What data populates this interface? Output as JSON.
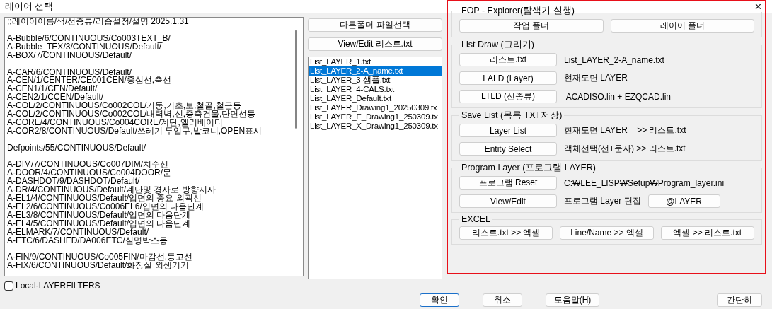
{
  "window": {
    "title": "레이어 선택",
    "close": "✕"
  },
  "layer_text": {
    "groups": [
      [
        ";;레이어이름/색/선종류/리습설정/설명 2025.1.31"
      ],
      [
        "A-Bubble/6/CONTINUOUS/Co003TEXT_B/",
        "A-Bubble_TEX/3/CONTINUOUS/Default/",
        "A-BOX/7/CONTINUOUS/Default/"
      ],
      [
        "A-CAR/6/CONTINUOUS/Default/",
        "A-CEN/1/CENTER/CE001CEN/중심선,축선",
        "A-CEN1/1/CEN/Default/",
        "A-CEN2/1/CCEN/Default/",
        "A-COL/2/CONTINUOUS/Co002COL/기둥,기초,보,철골,철근등",
        "A-COL/2/CONTINUOUS/Co002COL/내력벽,신,증축건물,단면선등",
        "A-CORE/4/CONTINUOUS/Co004CORE/계단,엘리베이터",
        "A-COR2/8/CONTINUOUS/Default/쓰레기 투입구,발코니,OPEN표시"
      ],
      [
        "Defpoints/55/CONTINUOUS/Default/"
      ],
      [
        "A-DIM/7/CONTINUOUS/Co007DIM/치수선",
        "A-DOOR/4/CONTINUOUS/Co004DOOR/문",
        "A-DASHDOT/9/DASHDOT/Default/",
        "A-DR/4/CONTINUOUS/Default/계단및 경사로 방향지사",
        "A-EL1/4/CONTINUOUS/Default/입면의 중요 외곽선",
        "A-EL2/6/CONTINUOUS/Co006EL6/입면의 다음단계",
        "A-EL3/8/CONTINUOUS/Default/입면의 다음단계",
        "A-EL4/5/CONTINUOUS/Default/입면의 다음단계",
        "A-ELMARK/7/CONTINUOUS/Default/",
        "A-ETC/6/DASHED/DA006ETC/실명박스등"
      ],
      [
        "A-FIN/9/CONTINUOUS/Co005FIN/마감선,등고선",
        "A-FIX/6/CONTINUOUS/Default/화장실 외생기기"
      ]
    ]
  },
  "local_filters": {
    "label": "Local-LAYERFILTERS",
    "checked": false
  },
  "file_buttons": [
    "다른폴더 파일선택",
    "View/Edit 리스트.txt"
  ],
  "file_list": [
    {
      "label": "List_LAYER_1.txt",
      "selected": false
    },
    {
      "label": "List_LAYER_2-A_name.txt",
      "selected": true
    },
    {
      "label": "List_LAYER_3-샘플.txt",
      "selected": false
    },
    {
      "label": "List_LAYER_4-CALS.txt",
      "selected": false
    },
    {
      "label": "List_LAYER_Default.txt",
      "selected": false
    },
    {
      "label": "List_LAYER_Drawing1_20250309.tx",
      "selected": false
    },
    {
      "label": "List_LAYER_E_Drawing1_250309.tx",
      "selected": false
    },
    {
      "label": "List_LAYER_X_Drawing1_250309.tx",
      "selected": false
    }
  ],
  "panel": {
    "groups": [
      {
        "title": "FOP - Explorer(탐색기 실행)",
        "rows": [
          {
            "kind": "buttons",
            "buttons": [
              "작업 폴더",
              "레이어 폴더"
            ]
          }
        ]
      },
      {
        "title": "List Draw (그리기)",
        "rows": [
          {
            "kind": "action",
            "button": "리스트.txt",
            "text": "List_LAYER_2-A_name.txt"
          },
          {
            "kind": "action",
            "button": "LALD  (Layer)",
            "text": "현재도면 LAYER"
          },
          {
            "kind": "action",
            "button": "LTLD (선종류)",
            "text": " ACADISO.lin + EZQCAD.lin"
          }
        ]
      },
      {
        "title": "Save List (목록 TXT저장)",
        "rows": [
          {
            "kind": "action",
            "button": "Layer List",
            "text": "현재도면 LAYER    >> 리스트.txt"
          },
          {
            "kind": "action",
            "button": "Entity Select",
            "text": "객체선택(선+문자) >> 리스트.txt"
          }
        ]
      },
      {
        "title": "Program Layer (프로그램 LAYER)",
        "rows": [
          {
            "kind": "action",
            "button": "프로그램 Reset",
            "text": "C:₩LEE_LISP₩Setup₩Program_layer.ini"
          },
          {
            "kind": "action",
            "button": "View/Edit",
            "text": "프로그램 Layer 편집",
            "extra_button": "@LAYER"
          }
        ]
      },
      {
        "title": "EXCEL",
        "rows": [
          {
            "kind": "buttons",
            "buttons": [
              "리스트.txt >> 엑셀",
              "Line/Name >> 엑셀",
              "엑셀 >> 리스트.txt"
            ]
          }
        ]
      }
    ]
  },
  "footer": {
    "buttons": [
      {
        "label": "확인",
        "focused": true
      },
      {
        "label": "취소",
        "focused": false
      },
      {
        "label": "도움말(H)",
        "focused": false
      }
    ],
    "toggle_button": "간단히"
  }
}
